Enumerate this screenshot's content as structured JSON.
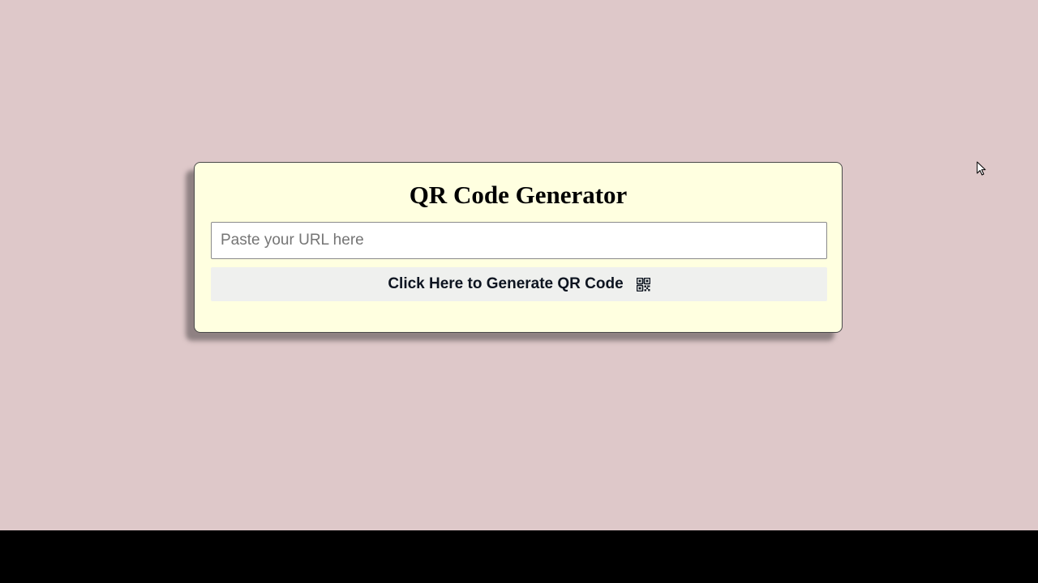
{
  "page": {
    "background_color": "#dec8c9",
    "taskbar_color": "#000000"
  },
  "card": {
    "background_color": "#ffffe0",
    "title": "QR Code Generator"
  },
  "url_input": {
    "value": "",
    "placeholder": "Paste your URL here"
  },
  "generate_button": {
    "label": "Click Here to Generate QR Code",
    "icon": "qrcode-icon",
    "background_color": "#eff0ee"
  },
  "cursor": {
    "icon": "mouse-pointer-icon"
  }
}
